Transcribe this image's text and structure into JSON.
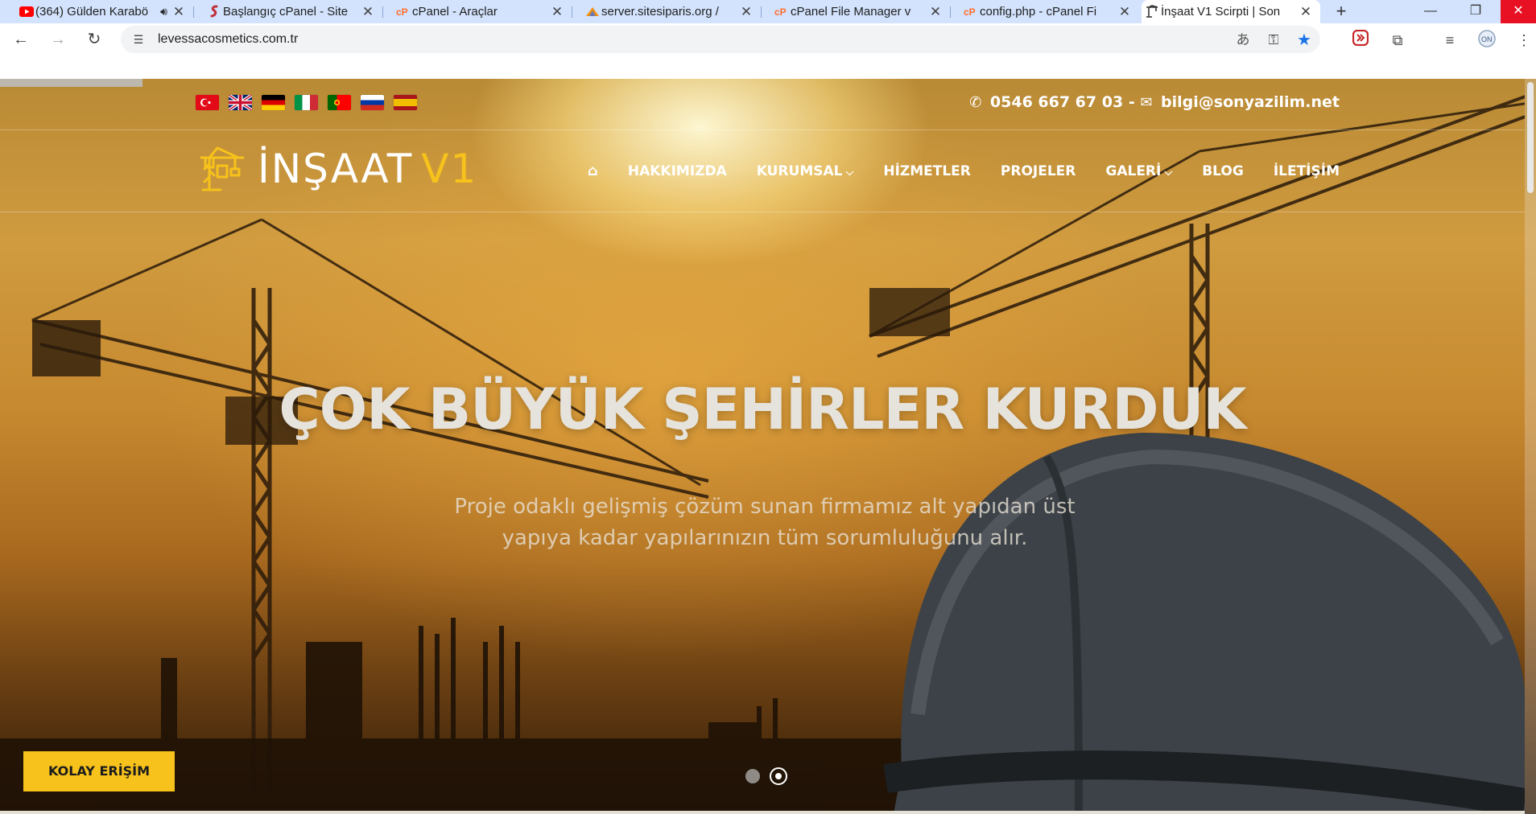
{
  "browser": {
    "tabs": [
      {
        "title": "(364) Gülden Karabö",
        "favicon": "youtube-icon",
        "audio": true
      },
      {
        "title": "Başlangıç cPanel - Site",
        "favicon": "cpanel-start-icon"
      },
      {
        "title": "cPanel - Araçlar",
        "favicon": "cpanel-icon"
      },
      {
        "title": "server.sitesiparis.org /",
        "favicon": "phpmyadmin-icon"
      },
      {
        "title": "cPanel File Manager v",
        "favicon": "cpanel-icon"
      },
      {
        "title": "config.php - cPanel Fi",
        "favicon": "cpanel-icon"
      },
      {
        "title": "İnşaat V1 Scirpti | Son",
        "favicon": "crane-icon",
        "active": true
      }
    ],
    "new_tab": "+",
    "url": "levessacosmetics.com.tr"
  },
  "site": {
    "flags": [
      "tr",
      "gb",
      "de",
      "it",
      "pt",
      "ru",
      "es"
    ],
    "contact": {
      "phone": "0546 667 67 03",
      "separator": "-",
      "email": "bilgi@sonyazilim.net"
    },
    "logo": {
      "main": "İNŞAAT",
      "accent": "V1"
    },
    "menu": [
      {
        "label": "HAKKIMIZDA",
        "dropdown": false
      },
      {
        "label": "KURUMSAL",
        "dropdown": true
      },
      {
        "label": "HİZMETLER",
        "dropdown": false
      },
      {
        "label": "PROJELER",
        "dropdown": false
      },
      {
        "label": "GALERİ",
        "dropdown": true
      },
      {
        "label": "BLOG",
        "dropdown": false
      },
      {
        "label": "İLETİŞİM",
        "dropdown": false
      }
    ],
    "hero": {
      "title": "ÇOK BÜYÜK ŞEHİRLER KURDUK",
      "subtitle": "Proje odaklı gelişmiş çözüm sunan firmamız alt yapıdan üst yapıya kadar yapılarınızın tüm sorumluluğunu alır."
    },
    "cta": "KOLAY ERİŞİM",
    "slider": {
      "count": 2,
      "active": 2
    },
    "colors": {
      "accent": "#f6c21b",
      "text": "#ffffff"
    }
  }
}
